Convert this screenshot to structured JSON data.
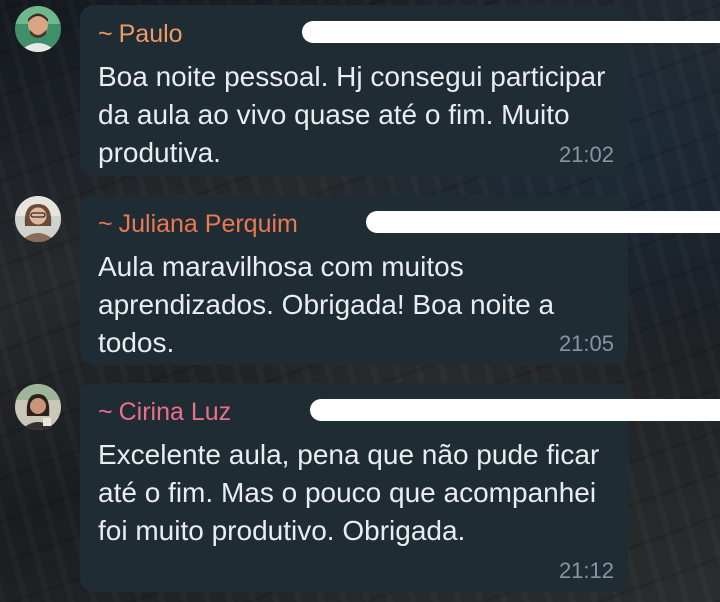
{
  "messages": [
    {
      "sender": "Paulo",
      "prefix": "~",
      "sender_color": "#ee9a66",
      "text": "Boa noite pessoal.  Hj consegui participar da aula ao vivo quase até o fim. Muito produtiva.",
      "time": "21:02",
      "avatar_icon": "profile-photo-man"
    },
    {
      "sender": "Juliana Perquim",
      "prefix": "~",
      "sender_color": "#e87952",
      "text": "Aula maravilhosa com muitos aprendizados. Obrigada! Boa noite a todos.",
      "time": "21:05",
      "avatar_icon": "profile-photo-woman"
    },
    {
      "sender": "Cirina Luz",
      "prefix": "~",
      "sender_color": "#e8708a",
      "text": "Excelente aula, pena que não pude ficar até o fim. Mas o pouco que acompanhei foi muito produtivo. Obrigada.",
      "time": "21:12",
      "avatar_icon": "profile-photo-woman"
    }
  ]
}
